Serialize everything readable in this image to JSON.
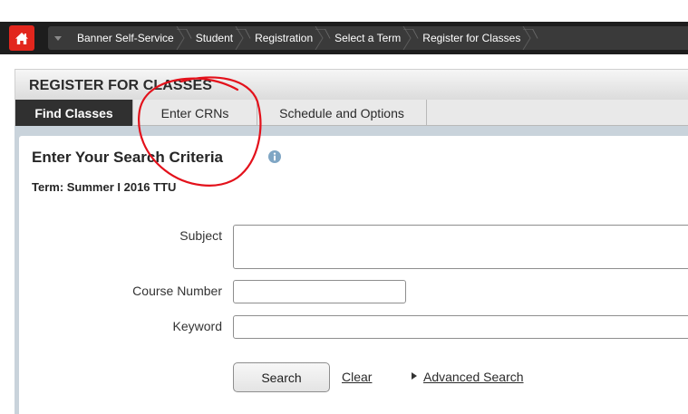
{
  "topbar": {
    "home_icon": "home-icon",
    "menu_icon": "chevron-down-icon",
    "breadcrumbs": [
      {
        "label": "Banner Self-Service"
      },
      {
        "label": "Student"
      },
      {
        "label": "Registration"
      },
      {
        "label": "Select a Term"
      },
      {
        "label": "Register for Classes"
      }
    ]
  },
  "page": {
    "title": "REGISTER FOR CLASSES"
  },
  "tabs": [
    {
      "label": "Find Classes",
      "active": true
    },
    {
      "label": "Enter CRNs",
      "active": false
    },
    {
      "label": "Schedule and Options",
      "active": false
    }
  ],
  "search": {
    "heading": "Enter Your Search Criteria",
    "info_icon": "info-icon",
    "term_label": "Term: Summer I 2016 TTU",
    "subject_label": "Subject",
    "subject_value": "",
    "course_number_label": "Course Number",
    "course_number_value": "",
    "keyword_label": "Keyword",
    "keyword_value": "",
    "search_button": "Search",
    "clear_link": "Clear",
    "advanced_link": "Advanced Search"
  },
  "colors": {
    "topbar": "#1d1d1d",
    "home_button": "#e2261d",
    "active_tab": "#303030",
    "panel_frame": "#c9d3db",
    "info_icon": "#7fa6c4",
    "annotation": "#e3111b"
  }
}
